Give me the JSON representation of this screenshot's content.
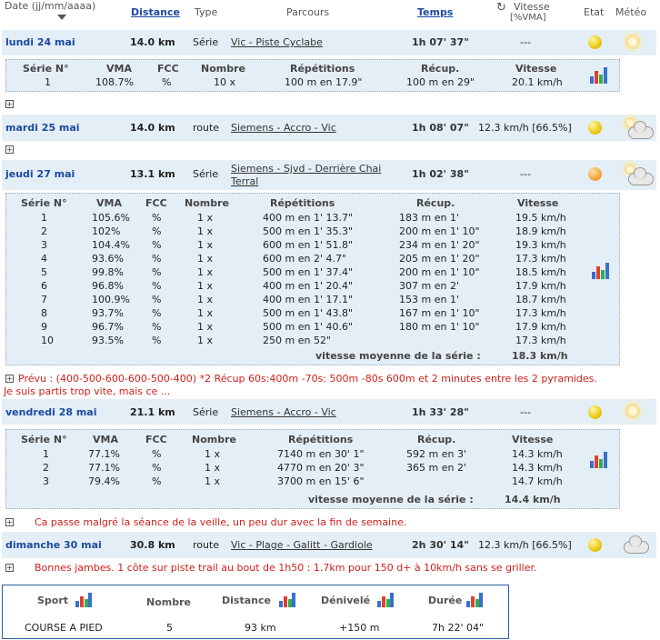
{
  "header": {
    "date": "Date (jj/mm/aaaa)",
    "distance": "Distance",
    "type": "Type",
    "parcours": "Parcours",
    "temps": "Temps",
    "vitesse": "Vitesse",
    "vitesse_sub": "[%VMA]",
    "etat": "Etat",
    "meteo": "Météo"
  },
  "detail_cols": {
    "serie": "Série N°",
    "vma": "VMA",
    "fcc": "FCC",
    "nombre": "Nombre",
    "repetitions": "Répétitions",
    "recup": "Récup.",
    "vitesse": "Vitesse"
  },
  "sessions": [
    {
      "day": "lundi 24 mai",
      "distance": "14.0 km",
      "type": "Série",
      "parcours": "Vic - Piste Cyclabe",
      "temps": "1h 07' 37\"",
      "vitesse": "---",
      "etat": "happy",
      "meteo": "sun",
      "series": [
        {
          "n": "1",
          "vma": "108.7%",
          "fcc": "%",
          "nombre": "10 x",
          "rep": "100 m en 17.9\"",
          "recup": "100 m en 29\"",
          "vit": "20.1 km/h"
        }
      ]
    },
    {
      "day": "mardi 25 mai",
      "distance": "14.0 km",
      "type": "route",
      "parcours": "Siemens - Accro - Vic",
      "temps": "1h 08' 07\"",
      "vitesse": "12.3 km/h [66.5%]",
      "etat": "happy",
      "meteo": "sun-cloud"
    },
    {
      "day": "jeudi 27 mai",
      "distance": "13.1 km",
      "type": "Série",
      "parcours_l1": "Siemens - Sjvd - Derrière Chai",
      "parcours_l2": "Terral",
      "temps": "1h 02' 38\"",
      "vitesse": "---",
      "etat": "sad",
      "meteo": "sun-cloud",
      "series": [
        {
          "n": "1",
          "vma": "105.6%",
          "fcc": "%",
          "nombre": "1 x",
          "rep": "400 m en 1' 13.7\"",
          "recup": "183 m en 1'",
          "vit": "19.5 km/h"
        },
        {
          "n": "2",
          "vma": "102%",
          "fcc": "%",
          "nombre": "1 x",
          "rep": "500 m en 1' 35.3\"",
          "recup": "200 m en 1' 10\"",
          "vit": "18.9 km/h"
        },
        {
          "n": "3",
          "vma": "104.4%",
          "fcc": "%",
          "nombre": "1 x",
          "rep": "600 m en 1' 51.8\"",
          "recup": "234 m en 1' 20\"",
          "vit": "19.3 km/h"
        },
        {
          "n": "4",
          "vma": "93.6%",
          "fcc": "%",
          "nombre": "1 x",
          "rep": "600 m en 2' 4.7\"",
          "recup": "205 m en 1' 20\"",
          "vit": "17.3 km/h"
        },
        {
          "n": "5",
          "vma": "99.8%",
          "fcc": "%",
          "nombre": "1 x",
          "rep": "500 m en 1' 37.4\"",
          "recup": "200 m en 1' 10\"",
          "vit": "18.5 km/h"
        },
        {
          "n": "6",
          "vma": "96.8%",
          "fcc": "%",
          "nombre": "1 x",
          "rep": "400 m en 1' 20.4\"",
          "recup": "307 m en 2'",
          "vit": "17.9 km/h"
        },
        {
          "n": "7",
          "vma": "100.9%",
          "fcc": "%",
          "nombre": "1 x",
          "rep": "400 m en 1' 17.1\"",
          "recup": "153 m en 1'",
          "vit": "18.7 km/h"
        },
        {
          "n": "8",
          "vma": "93.7%",
          "fcc": "%",
          "nombre": "1 x",
          "rep": "500 m en 1' 43.8\"",
          "recup": "167 m en 1' 10\"",
          "vit": "17.3 km/h"
        },
        {
          "n": "9",
          "vma": "96.7%",
          "fcc": "%",
          "nombre": "1 x",
          "rep": "500 m en 1' 40.6\"",
          "recup": "180 m en 1' 10\"",
          "vit": "17.9 km/h"
        },
        {
          "n": "10",
          "vma": "93.5%",
          "fcc": "%",
          "nombre": "1 x",
          "rep": "250 m en 52\"",
          "recup": "",
          "vit": "17.3 km/h"
        }
      ],
      "avg_label": "vitesse moyenne de la série :",
      "avg_value": "18.3 km/h",
      "note_l1": "Prévu : (400-500-600-600-500-400) *2 Récup 60s:400m -70s: 500m -80s 600m et 2 minutes entre les 2 pyramides.",
      "note_l2": "Je suis partis trop vite, mais ce ..."
    },
    {
      "day": "vendredi 28 mai",
      "distance": "21.1 km",
      "type": "Série",
      "parcours": "Siemens - Accro - Vic",
      "temps": "1h 33' 28\"",
      "vitesse": "---",
      "etat": "happy",
      "meteo": "sun",
      "series": [
        {
          "n": "1",
          "vma": "77.1%",
          "fcc": "%",
          "nombre": "1 x",
          "rep": "7140 m en 30' 1\"",
          "recup": "592 m en 3'",
          "vit": "14.3 km/h"
        },
        {
          "n": "2",
          "vma": "77.1%",
          "fcc": "%",
          "nombre": "1 x",
          "rep": "4770 m en 20' 3\"",
          "recup": "365 m en 2'",
          "vit": "14.3 km/h"
        },
        {
          "n": "3",
          "vma": "79.4%",
          "fcc": "%",
          "nombre": "1 x",
          "rep": "3700 m en 15' 6\"",
          "recup": "",
          "vit": "14.7 km/h"
        }
      ],
      "avg_label": "vitesse moyenne de la série :",
      "avg_value": "14.4 km/h",
      "note": "Ca passe malgré la séance de la veille, un peu dur avec la fin de semaine."
    },
    {
      "day": "dimanche 30 mai",
      "distance": "30.8 km",
      "type": "route",
      "parcours": "Vic - Plage - Galitt - Gardiole",
      "temps": "2h 30' 14\"",
      "vitesse": "12.3 km/h [66.5%]",
      "etat": "happy",
      "meteo": "cloud",
      "note": "Bonnes jambes. 1 côte sur piste trail au bout de 1h50 : 1.7km pour 150 d+ à 10km/h sans se griller."
    }
  ],
  "summary": {
    "sport_label": "Sport",
    "nombre_label": "Nombre",
    "distance_label": "Distance",
    "denivele_label": "Dénivelé",
    "duree_label": "Durée",
    "sport": "COURSE A PIED",
    "nombre": "5",
    "distance": "93 km",
    "denivele": "+150 m",
    "duree": "7h 22' 04\""
  },
  "colors": {
    "row_bg": "#e4eef6",
    "link": "#1c4aa0",
    "note": "#d0201a",
    "summary_border": "#2a5ea8"
  }
}
